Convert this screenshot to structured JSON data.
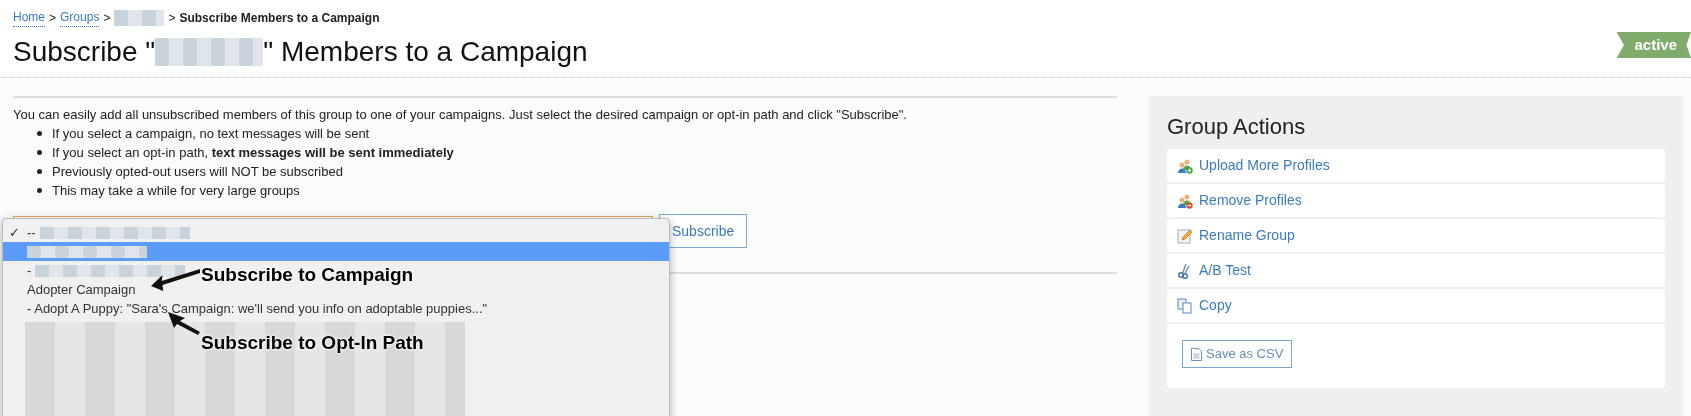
{
  "breadcrumb": {
    "items": [
      {
        "text": "Home",
        "kind": "link"
      },
      {
        "text": "Groups",
        "kind": "link"
      },
      {
        "kind": "redacted"
      }
    ],
    "separator": ">",
    "current": "Subscribe Members to a Campaign"
  },
  "title": {
    "before": "Subscribe \"",
    "redacted": true,
    "after": "\" Members to a Campaign"
  },
  "status_badge": "active",
  "intro": "You can easily add all unsubscribed members of this group to one of your campaigns. Just select the desired campaign or opt-in path and click \"Subscribe\".",
  "bullets": [
    "If you select a campaign, no text messages will be sent",
    "If you select an opt-in path, **text messages will be sent immediately**",
    "Previously opted-out users will NOT be subscribed",
    "This may take a while for very large groups"
  ],
  "dropdown": {
    "check_glyph": "✓",
    "options": [
      {
        "text": "--",
        "redacted": true,
        "checked": true,
        "selected": false
      },
      {
        "redacted": true,
        "checked": false,
        "selected": true
      },
      {
        "text": "-",
        "redacted": true,
        "checked": false,
        "selected": false
      },
      {
        "text": "Adopter Campaign",
        "redacted": false,
        "checked": false,
        "selected": false
      },
      {
        "text": "- Adopt A Puppy: \"Sara's Campaign: we'll send you info on adoptable puppies...\"",
        "redacted": false,
        "checked": false,
        "selected": false
      }
    ],
    "redacted_tail": true
  },
  "annotations": [
    {
      "text": "Subscribe to Campaign"
    },
    {
      "text": "Subscribe to Opt-In Path"
    }
  ],
  "subscribe_button": "Subscribe",
  "group_actions": {
    "title": "Group Actions",
    "items": [
      {
        "kind": "upload",
        "label": "Upload More Profiles"
      },
      {
        "kind": "remove",
        "label": "Remove Profiles"
      },
      {
        "kind": "rename",
        "label": "Rename Group"
      },
      {
        "kind": "ab",
        "label": "A/B Test"
      },
      {
        "kind": "copy",
        "label": "Copy"
      }
    ],
    "csv_button": "Save as CSV"
  }
}
